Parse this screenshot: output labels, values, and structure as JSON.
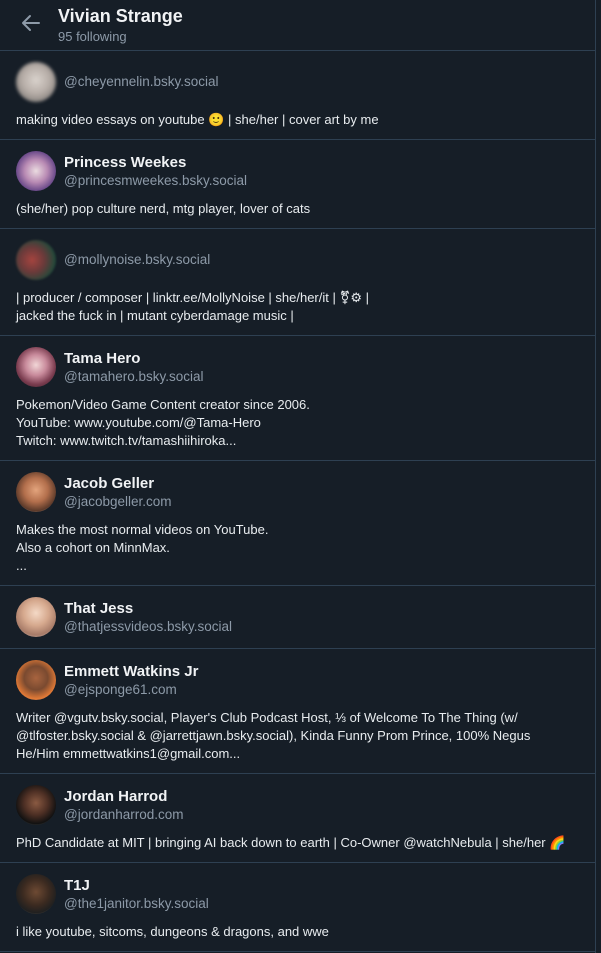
{
  "header": {
    "title": "Vivian Strange",
    "subtitle": "95 following"
  },
  "rows": [
    {
      "display_name": "",
      "handle": "@cheyennelin.bsky.social",
      "bio": "making video essays on youtube 🙂 | she/her | cover art by me"
    },
    {
      "display_name": "Princess Weekes",
      "handle": "@princesmweekes.bsky.social",
      "bio": "(she/her) pop culture nerd, mtg player, lover of cats"
    },
    {
      "display_name": "",
      "handle": "@mollynoise.bsky.social",
      "bio": "| producer / composer | linktr.ee/MollyNoise | she/her/it | ⚧⚙ |\njacked the fuck in | mutant cyberdamage music |"
    },
    {
      "display_name": "Tama Hero",
      "handle": "@tamahero.bsky.social",
      "bio": "Pokemon/Video Game Content creator since 2006.\nYouTube: www.youtube.com/@Tama-Hero\nTwitch: www.twitch.tv/tamashiihiroka..."
    },
    {
      "display_name": "Jacob Geller",
      "handle": "@jacobgeller.com",
      "bio": "Makes the most normal videos on YouTube.\nAlso a cohort on MinnMax.\n..."
    },
    {
      "display_name": "That Jess",
      "handle": "@thatjessvideos.bsky.social",
      "bio": ""
    },
    {
      "display_name": "Emmett Watkins Jr",
      "handle": "@ejsponge61.com",
      "bio": "Writer @vgutv.bsky.social, Player's Club Podcast Host, ⅓ of Welcome To The Thing (w/ @tlfoster.bsky.social & @jarrettjawn.bsky.social), Kinda Funny Prom Prince, 100% Negus\nHe/Him  emmettwatkins1@gmail.com..."
    },
    {
      "display_name": "Jordan Harrod",
      "handle": "@jordanharrod.com",
      "bio": "PhD Candidate at MIT | bringing AI back down to earth | Co-Owner @watchNebula | she/her 🌈"
    },
    {
      "display_name": "T1J",
      "handle": "@the1janitor.bsky.social",
      "bio": "i like youtube, sitcoms, dungeons & dragons, and wwe"
    }
  ],
  "colors": {
    "background": "#161e27",
    "divider": "#2e4052",
    "muted_text": "#8d9aa8",
    "primary_text": "#f1f3f5"
  },
  "icons": {
    "back": "arrow-left-icon"
  }
}
